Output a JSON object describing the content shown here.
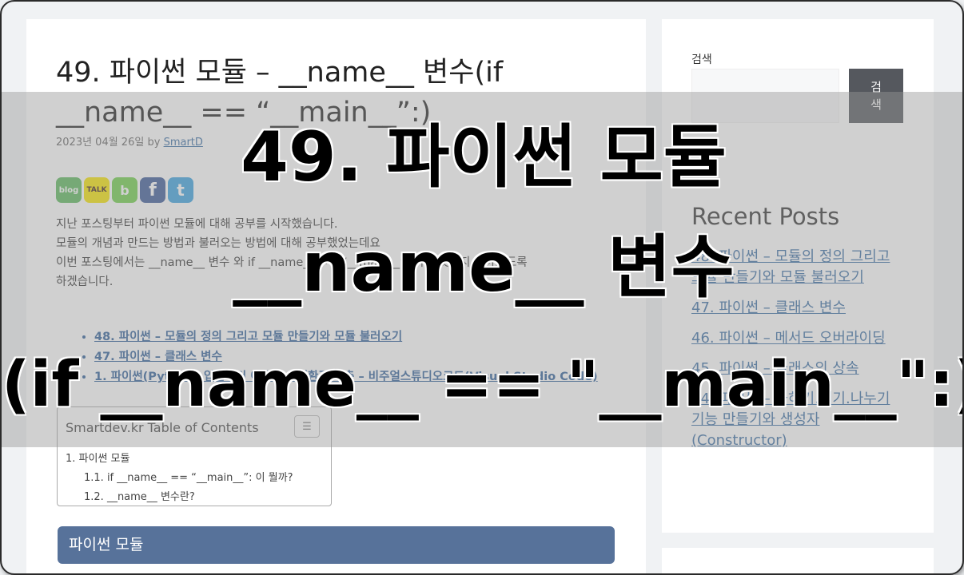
{
  "post": {
    "title": "49. 파이썬 모듈 – __name__ 변수(if __name__ == “__main__”:)",
    "date": "2023년 04월 26일",
    "by": "by",
    "author": "SmartD",
    "share": [
      "blog",
      "TALK",
      "b",
      "f",
      "t"
    ],
    "intro": [
      "지난 포스팅부터 파이썬 모듈에 대해 공부를 시작했습니다.",
      "모듈의 개념과 만드는 방법과 불러오는 방법에 대해 공부했었는데요",
      "이번 포스팅에서는 __name__ 변수 와 if __name__ == “__main__”: 이 무엇인지 알아보도록",
      "하겠습니다."
    ],
    "related": [
      "48. 파이썬 – 모듈의 정의 그리고 모듈 만들기와 모듈 불러오기",
      "47. 파이썬 – 클래스 변수",
      "1. 파이썬(Python) 입문부터 이론과 실행환경 구축 – 비주얼스튜디오코드(Visual Studio Code)"
    ]
  },
  "toc": {
    "title": "Smartdev.kr Table of Contents",
    "toggle": "☰",
    "l1": "1. 파이썬 모듈",
    "l2a": "1.1. if __name__ == “__main__”: 이 뭘까?",
    "l2b": "1.2. __name__ 변수란?"
  },
  "section_head": "파이썬 모듈",
  "sidebar": {
    "search_label": "검색",
    "search_button": "검\n색",
    "recent_title": "Recent Posts",
    "recent": [
      "48. 파이썬 – 모듈의 정의 그리고 모듈 만들기와 모듈 불러오기",
      "47. 파이썬 – 클래스 변수",
      "46. 파이썬 – 메서드 오버라이딩",
      "45. 파이썬 – 클래스의 상속",
      "44. 파이썬 – 곱하기.빼기.나누기 기능 만들기와 생성자(Constructor)"
    ]
  },
  "overlay": {
    "line1": "49. 파이썬 모듈",
    "line2": "__name__ 변수",
    "line3": "(if __name__ == \"__main__\":)"
  },
  "colors": {
    "section_bg": "#57729a",
    "link": "#3a6ea5",
    "search_button_bg": "#55585e"
  }
}
